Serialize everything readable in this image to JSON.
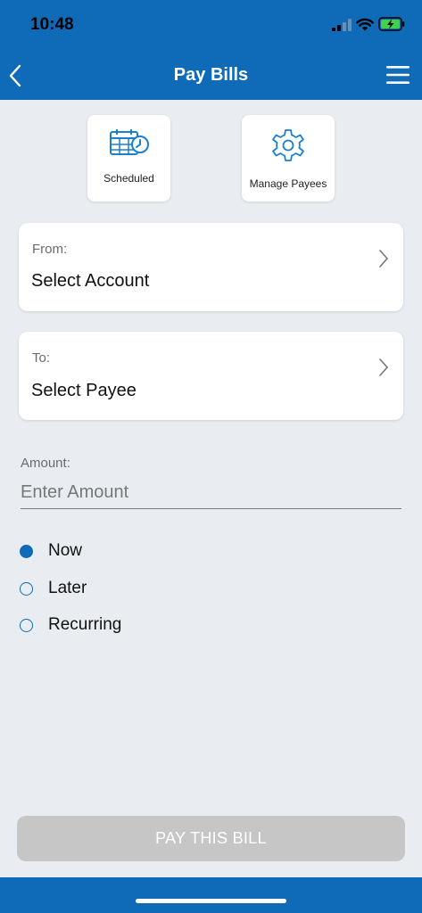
{
  "status_bar": {
    "time": "10:48"
  },
  "header": {
    "title": "Pay Bills"
  },
  "shortcuts": [
    {
      "label": "Scheduled",
      "icon": "calendar-clock-icon"
    },
    {
      "label": "Manage Payees",
      "icon": "gear-icon"
    }
  ],
  "from": {
    "label": "From:",
    "value": "Select Account"
  },
  "to": {
    "label": "To:",
    "value": "Select Payee"
  },
  "amount": {
    "label": "Amount:",
    "placeholder": "Enter Amount",
    "value": ""
  },
  "schedule_options": [
    {
      "label": "Now",
      "selected": true
    },
    {
      "label": "Later",
      "selected": false
    },
    {
      "label": "Recurring",
      "selected": false
    }
  ],
  "submit": {
    "label": "PAY THIS BILL",
    "enabled": false
  },
  "colors": {
    "primary": "#0f6bb8",
    "background": "#e9edf1",
    "button_disabled": "#c6c6c6"
  }
}
